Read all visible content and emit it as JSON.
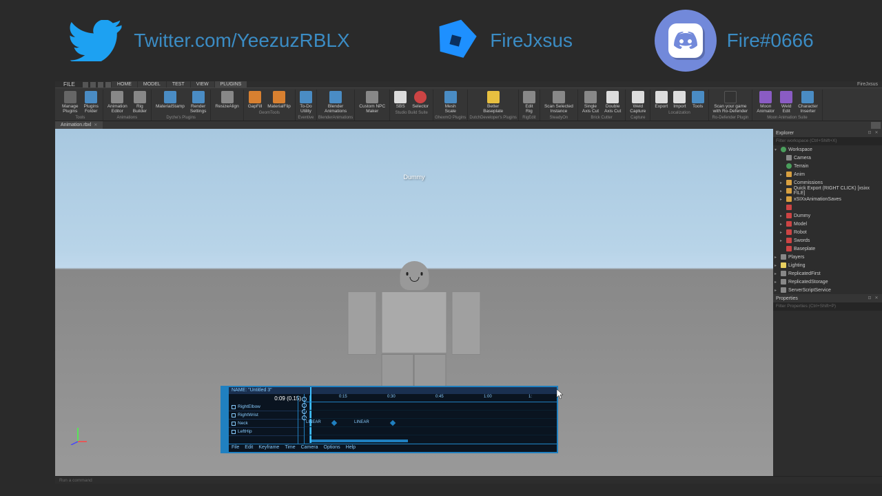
{
  "overlay": {
    "twitter": "Twitter.com/YeezuzRBLX",
    "fire": "FireJxsus",
    "discord": "Fire#0666"
  },
  "menubar": {
    "file": "FILE",
    "tabs": [
      "HOME",
      "MODEL",
      "TEST",
      "VIEW",
      "PLUGINS"
    ],
    "username": "FireJxsus"
  },
  "ribbon": {
    "groups": [
      {
        "label": "Tools",
        "items": [
          {
            "l": "Manage\nPlugins"
          },
          {
            "l": "Plugins\nFolder"
          }
        ]
      },
      {
        "label": "Animations",
        "items": [
          {
            "l": "Animation\nEditor"
          },
          {
            "l": "Rig\nBuilder"
          }
        ]
      },
      {
        "label": "Dyche's Plugins",
        "items": [
          {
            "l": "MaterialStamp"
          },
          {
            "l": "Render\nSettings"
          }
        ]
      },
      {
        "label": "",
        "items": [
          {
            "l": "ResizeAlign"
          }
        ]
      },
      {
        "label": "GeomTools",
        "items": [
          {
            "l": "GapFill"
          },
          {
            "l": "MaterialFlip"
          }
        ]
      },
      {
        "label": "Eventive",
        "items": [
          {
            "l": "To-Do\nUtility"
          }
        ]
      },
      {
        "label": "BlenderAnimations",
        "items": [
          {
            "l": "Blender\nAnimations"
          }
        ]
      },
      {
        "label": "",
        "items": [
          {
            "l": "Custom NPC\nMaker"
          }
        ]
      },
      {
        "label": "Studio Build Suite",
        "items": [
          {
            "l": "SBS"
          },
          {
            "l": "Selector"
          }
        ]
      },
      {
        "label": "GhexmO Plugins",
        "items": [
          {
            "l": "Mesh\nScale"
          }
        ]
      },
      {
        "label": "DutchDeveloper's Plugins",
        "items": [
          {
            "l": "Better\nBaseplate"
          }
        ]
      },
      {
        "label": "RigEdit",
        "items": [
          {
            "l": "Edit\nRig"
          }
        ]
      },
      {
        "label": "SteadyOn",
        "items": [
          {
            "l": "Scan Selected\nInstance"
          }
        ]
      },
      {
        "label": "Brick Cutter",
        "items": [
          {
            "l": "Single\nAxis Cut"
          },
          {
            "l": "Double\nAxis Cut"
          }
        ]
      },
      {
        "label": "Capture",
        "items": [
          {
            "l": "Weld\nCapture"
          }
        ]
      },
      {
        "label": "Localization",
        "items": [
          {
            "l": "Export"
          },
          {
            "l": "Import"
          },
          {
            "l": "Tools"
          }
        ]
      },
      {
        "label": "Ro-Defender Plugin",
        "items": [
          {
            "l": "Scan your game\nwith Ro-Defender"
          }
        ]
      },
      {
        "label": "Moon Animation Suite",
        "items": [
          {
            "l": "Moon\nAnimator"
          },
          {
            "l": "Weld\nEdit"
          },
          {
            "l": "Character\nInserter"
          }
        ]
      }
    ]
  },
  "doc_tab": {
    "name": "Animation.rbxl"
  },
  "viewport": {
    "label": "Dummy"
  },
  "animator": {
    "title": "NAME: \"Untitled 3\"",
    "time": "0:09 (0.15)",
    "ruler": [
      "0:15",
      "0:30",
      "0:45",
      "1:00",
      "1:"
    ],
    "tracks": [
      "RightElbow",
      "RightWrist",
      "Neck",
      "LeftHip"
    ],
    "linear": "LINEAR",
    "menu": [
      "File",
      "Edit",
      "Keyframe",
      "Time",
      "Camera",
      "Options",
      "Help"
    ]
  },
  "explorer": {
    "title": "Explorer",
    "filter": "Filter workspace (Ctrl+Shift+X)",
    "items": [
      {
        "l": "Workspace",
        "i": "globe",
        "d": 0,
        "e": "▾"
      },
      {
        "l": "Camera",
        "i": "svc",
        "d": 1
      },
      {
        "l": "Terrain",
        "i": "globe",
        "d": 1
      },
      {
        "l": "Anim",
        "i": "folder",
        "d": 1,
        "e": "▸"
      },
      {
        "l": "Commissions",
        "i": "folder",
        "d": 1,
        "e": "▸"
      },
      {
        "l": "Quick Export (RIGHT CLICK) [xsixx FILE]",
        "i": "folder",
        "d": 1,
        "e": "▸"
      },
      {
        "l": "xSIXxAnimationSaves",
        "i": "folder",
        "d": 1,
        "e": "▸"
      },
      {
        "l": "",
        "i": "part",
        "d": 1
      },
      {
        "l": "Dummy",
        "i": "part",
        "d": 1,
        "e": "▸"
      },
      {
        "l": "Model",
        "i": "part",
        "d": 1,
        "e": "▸"
      },
      {
        "l": "Robot",
        "i": "part",
        "d": 1,
        "e": "▸"
      },
      {
        "l": "Swords",
        "i": "part",
        "d": 1,
        "e": "▸"
      },
      {
        "l": "Baseplate",
        "i": "part",
        "d": 1
      },
      {
        "l": "Players",
        "i": "svc",
        "d": 0,
        "e": "▸"
      },
      {
        "l": "Lighting",
        "i": "light",
        "d": 0,
        "e": "▸"
      },
      {
        "l": "ReplicatedFirst",
        "i": "svc",
        "d": 0,
        "e": "▸"
      },
      {
        "l": "ReplicatedStorage",
        "i": "svc",
        "d": 0,
        "e": "▸"
      },
      {
        "l": "ServerScriptService",
        "i": "svc",
        "d": 0,
        "e": "▸"
      }
    ]
  },
  "properties": {
    "title": "Properties",
    "filter": "Filter Properties (Ctrl+Shift+P)"
  },
  "commandbar": "Run a command"
}
